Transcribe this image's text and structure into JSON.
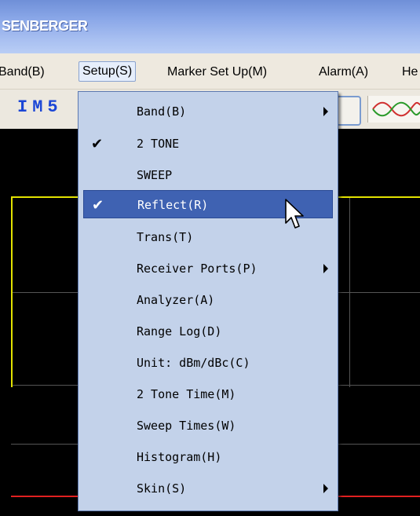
{
  "window": {
    "title": "SENBERGER"
  },
  "menubar": [
    {
      "label": "Band(B)"
    },
    {
      "label": "Setup(S)"
    },
    {
      "label": "Marker Set Up(M)"
    },
    {
      "label": "Alarm(A)"
    },
    {
      "label": "He"
    }
  ],
  "toolbar": {
    "display": "IM5"
  },
  "setup_menu": [
    {
      "label": "Band(B)",
      "checked": false,
      "submenu": true
    },
    {
      "label": "2 TONE",
      "checked": true,
      "submenu": false
    },
    {
      "label": "SWEEP",
      "checked": false,
      "submenu": false
    },
    {
      "label": "Reflect(R)",
      "checked": true,
      "submenu": false,
      "highlighted": true
    },
    {
      "label": "Trans(T)",
      "checked": false,
      "submenu": false
    },
    {
      "label": "Receiver Ports(P)",
      "checked": false,
      "submenu": true
    },
    {
      "label": "Analyzer(A)",
      "checked": false,
      "submenu": false
    },
    {
      "label": "Range Log(D)",
      "checked": false,
      "submenu": false
    },
    {
      "label": "Unit: dBm/dBc(C)",
      "checked": false,
      "submenu": false
    },
    {
      "label": "2 Tone Time(M)",
      "checked": false,
      "submenu": false
    },
    {
      "label": "Sweep Times(W)",
      "checked": false,
      "submenu": false
    },
    {
      "label": "Histogram(H)",
      "checked": false,
      "submenu": false
    },
    {
      "label": "Skin(S)",
      "checked": false,
      "submenu": true
    }
  ],
  "glyphs": {
    "check": "✔"
  },
  "colors": {
    "menu_bg": "#c3d2ea",
    "highlight": "#3f62b2",
    "grid_border": "#e2e200",
    "trace": "#e02020"
  }
}
